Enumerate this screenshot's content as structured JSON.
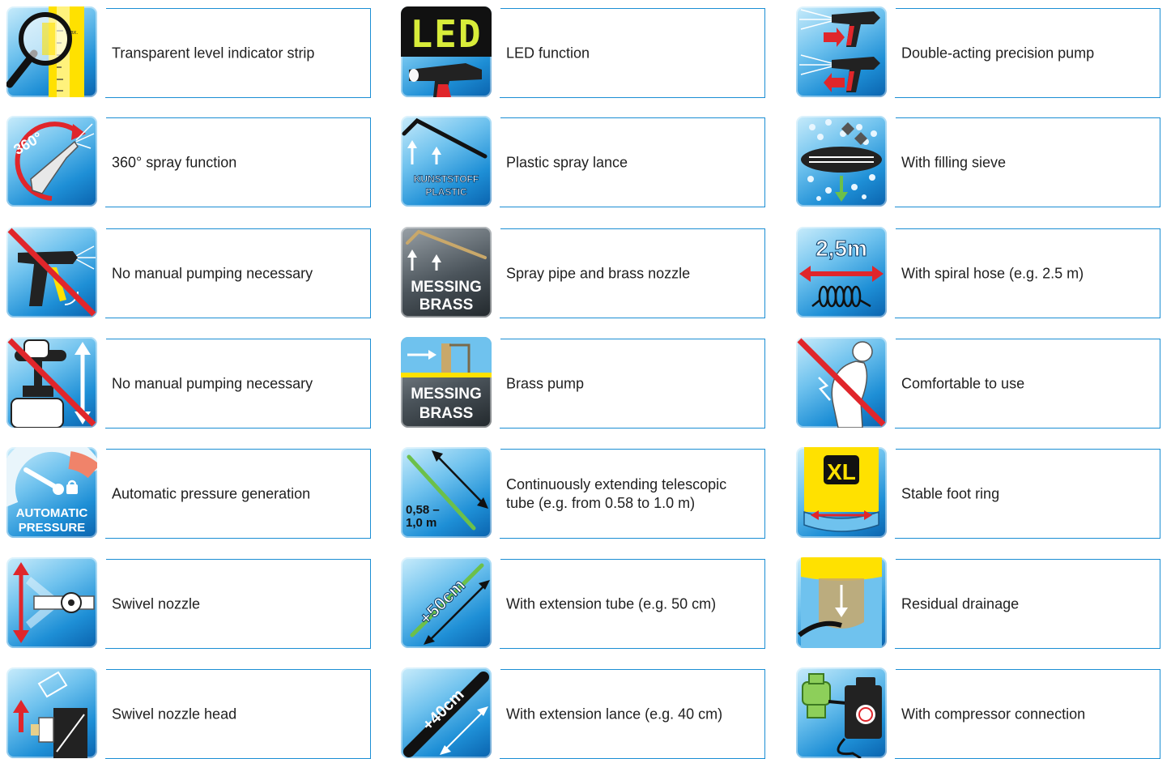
{
  "features": [
    {
      "label": "Transparent level indicator strip",
      "icon": "magnifier-level-icon"
    },
    {
      "label": "LED function",
      "icon": "led-spray-gun-icon",
      "icon_text": "LED"
    },
    {
      "label": "Double-acting precision pump",
      "icon": "double-pump-icon"
    },
    {
      "label": "360° spray function",
      "icon": "spray-360-icon",
      "icon_text": "360°"
    },
    {
      "label": "Plastic spray lance",
      "icon": "plastic-lance-icon",
      "icon_text": [
        "KUNSTSTOFF",
        "PLASTIC"
      ]
    },
    {
      "label": "With filling sieve",
      "icon": "filling-sieve-icon"
    },
    {
      "label": "No manual pumping necessary",
      "icon": "no-pump-gun-icon"
    },
    {
      "label": "Spray pipe and brass nozzle",
      "icon": "brass-lance-icon",
      "icon_text": [
        "MESSING",
        "BRASS"
      ]
    },
    {
      "label": "With spiral hose (e.g. 2.5 m)",
      "icon": "spiral-hose-icon",
      "icon_text": "2,5m"
    },
    {
      "label": "No manual pumping necessary",
      "icon": "no-pump-handle-icon"
    },
    {
      "label": "Brass pump",
      "icon": "brass-pump-icon",
      "icon_text": [
        "MESSING",
        "BRASS"
      ]
    },
    {
      "label": "Comfortable to use",
      "icon": "no-back-pain-icon"
    },
    {
      "label": "Automatic pressure generation",
      "icon": "automatic-pressure-icon",
      "icon_text": [
        "AUTOMATIC",
        "PRESSURE"
      ]
    },
    {
      "label": "Continuously extending telescopic tube (e.g. from 0.58 to 1.0 m)",
      "icon": "telescopic-tube-icon",
      "icon_text": [
        "0,58 –",
        "1,0 m"
      ]
    },
    {
      "label": "Stable foot ring",
      "icon": "foot-ring-icon",
      "icon_text": "XL"
    },
    {
      "label": "Swivel nozzle",
      "icon": "swivel-nozzle-icon"
    },
    {
      "label": "With extension tube (e.g. 50 cm)",
      "icon": "extension-tube-icon",
      "icon_text": "+50cm"
    },
    {
      "label": "Residual drainage",
      "icon": "residual-drainage-icon"
    },
    {
      "label": "Swivel nozzle head",
      "icon": "swivel-head-icon"
    },
    {
      "label": "With extension lance (e.g. 40 cm)",
      "icon": "extension-lance-icon",
      "icon_text": "+40cm"
    },
    {
      "label": "With compressor connection",
      "icon": "compressor-icon"
    }
  ],
  "colors": {
    "frame": "#1b8ed4",
    "tile_blue": "#1e8fd6",
    "red": "#e0262b",
    "green": "#6cc04a",
    "yellow": "#ffe100"
  }
}
